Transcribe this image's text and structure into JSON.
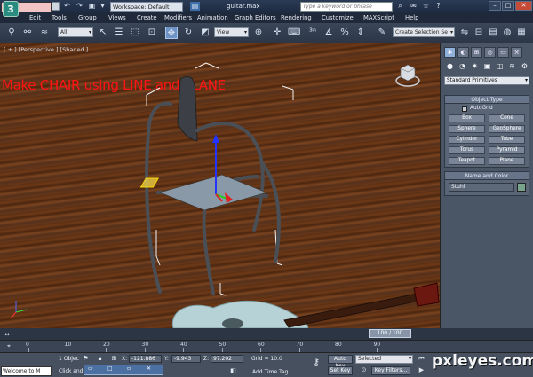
{
  "titlebar": {
    "logo": "3",
    "workspace_label": "Workspace: Default",
    "file_name": "guitar.max",
    "search_placeholder": "Type a keyword or phrase",
    "minimize": "–",
    "maximize": "□",
    "close": "✕"
  },
  "menu": {
    "items": [
      "Edit",
      "Tools",
      "Group",
      "Views",
      "Create",
      "Modifiers",
      "Animation",
      "Graph Editors",
      "Rendering",
      "Customize",
      "MAXScript",
      "Help"
    ]
  },
  "toolbar": {
    "selection_filter": "All",
    "ref_coord": "View",
    "named_selection": "Create Selection Se"
  },
  "viewport": {
    "label": "[ + ] [Perspective ] [Shaded ]",
    "caption": "Make CHAIR using LINE and PLANE"
  },
  "command_panel": {
    "category": "Standard Primitives",
    "object_type_title": "Object Type",
    "autogrid_label": "AutoGrid",
    "primitives": [
      "Box",
      "Cone",
      "Sphere",
      "GeoSphere",
      "Cylinder",
      "Tube",
      "Torus",
      "Pyramid",
      "Teapot",
      "Plane"
    ],
    "name_color_title": "Name and Color",
    "object_name": "Stuhl",
    "object_color": "#78a38a"
  },
  "timeline": {
    "frame_readout": "100 / 100",
    "ticks": [
      "0",
      "10",
      "20",
      "30",
      "40",
      "50",
      "60",
      "70",
      "80",
      "90"
    ]
  },
  "status": {
    "welcome": "Welcome to M",
    "selection_count": "1 Objec",
    "prompt": "Click and",
    "x_label": "X:",
    "x_value": "-121.886",
    "y_label": "Y:",
    "y_value": "-9.943",
    "z_label": "Z:",
    "z_value": "97.202",
    "grid": "Grid = 10.0",
    "auto_key": "Auto Key",
    "set_key": "Set Key",
    "key_mode": "Selected",
    "key_filters": "Key Filters...",
    "add_time_tag": "Add Time Tag"
  },
  "watermark": "pxleyes.com"
}
